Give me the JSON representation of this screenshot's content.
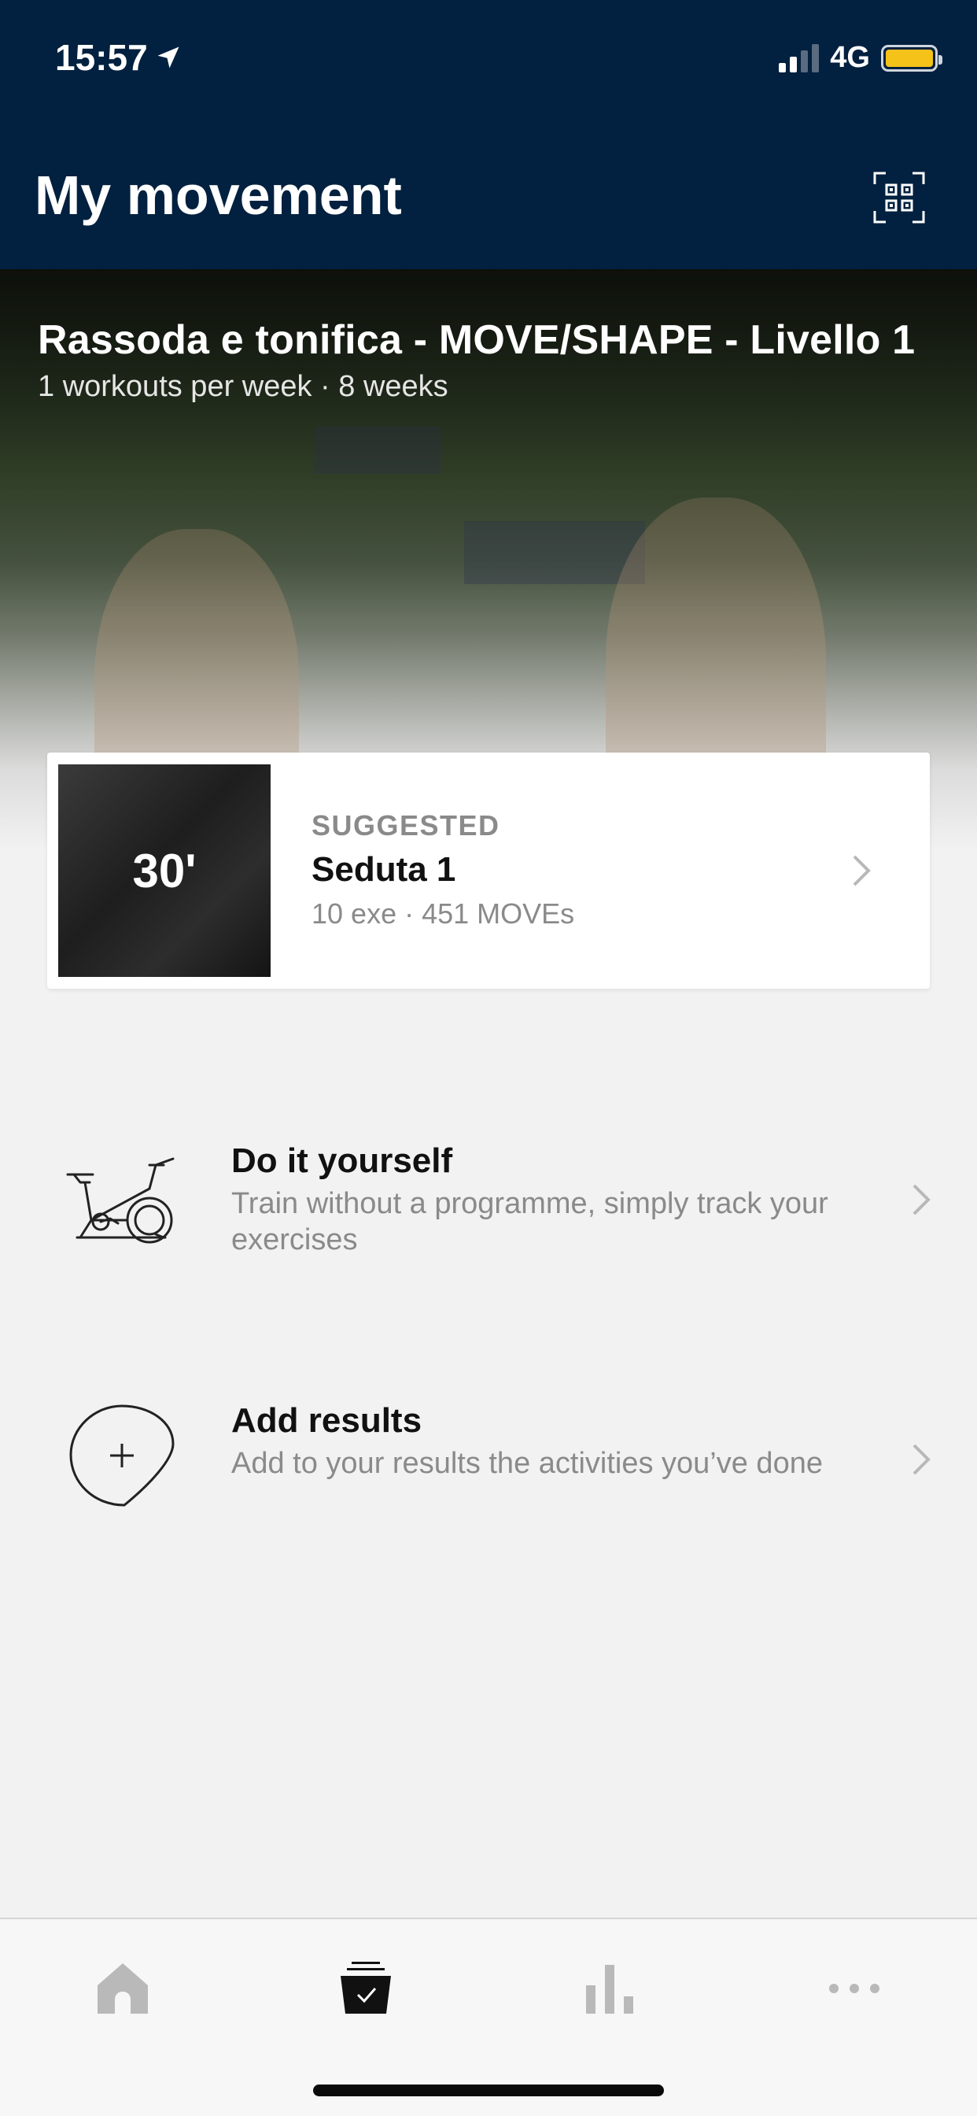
{
  "status": {
    "time": "15:57",
    "network": "4G",
    "location_icon": "location-arrow-icon",
    "battery_color": "#f5c21a"
  },
  "header": {
    "title": "My movement",
    "qr_icon": "qr-code-scan-icon",
    "background": "#02203f"
  },
  "program": {
    "title": "Rassoda e tonifica - MOVE/SHAPE - Livello 1",
    "subtitle": "1 workouts per week · 8 weeks"
  },
  "suggested": {
    "kicker": "SUGGESTED",
    "duration": "30'",
    "title": "Seduta 1",
    "meta": "10 exe · 451 MOVEs"
  },
  "options": [
    {
      "title": "Do it yourself",
      "description": "Train without a programme, simply track your exercises",
      "icon": "exercise-bike-icon"
    },
    {
      "title": "Add results",
      "description": "Add to your results the activities you’ve done",
      "icon": "add-result-icon"
    }
  ],
  "tabs": [
    {
      "name": "home",
      "icon": "home-icon",
      "active": false
    },
    {
      "name": "workouts",
      "icon": "workout-calendar-icon",
      "active": true
    },
    {
      "name": "stats",
      "icon": "bar-chart-icon",
      "active": false
    },
    {
      "name": "more",
      "icon": "more-dots-icon",
      "active": false
    }
  ]
}
